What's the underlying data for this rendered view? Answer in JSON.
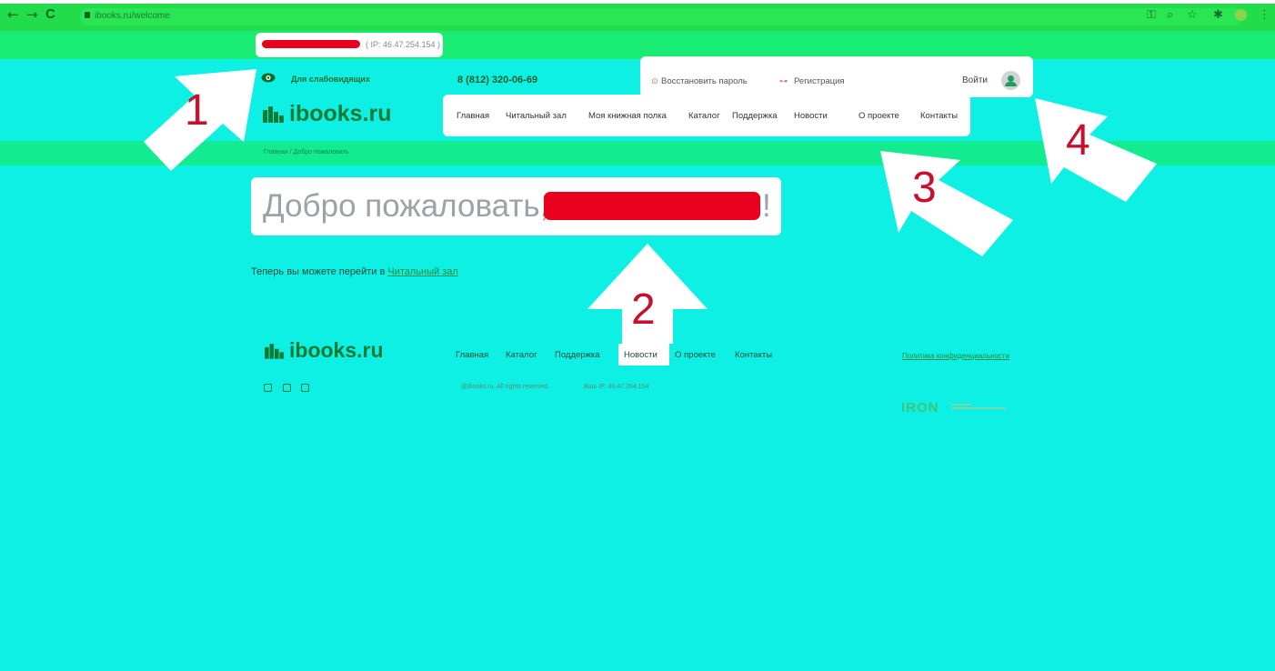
{
  "browser": {
    "url": "ibooks.ru/welcome",
    "back_glyph": "←",
    "forward_glyph": "→",
    "reload_glyph": "C",
    "menu_glyph": "⋮"
  },
  "header": {
    "ip_text": "( IP: 46.47.254.154 )",
    "accessibility_label": "Для слабовидящих",
    "phone": "8 (812) 320-06-69",
    "restore_password": "Восстановить пароль",
    "register": "Регистрация",
    "login": "Войти",
    "logo": "ibooks.ru"
  },
  "nav": {
    "items": [
      "Главная",
      "Читальный зал",
      "Моя книжная полка",
      "Каталог",
      "Поддержка",
      "Новости",
      "О проекте",
      "Контакты"
    ]
  },
  "breadcrumb": {
    "home": "Главная",
    "separator": "/",
    "current": "Добро пожаловать"
  },
  "main": {
    "welcome_title": "Добро пожаловать,",
    "welcome_suffix": "!",
    "reading_text": "Теперь вы можете перейти в",
    "reading_link": "Читальный зал"
  },
  "footer": {
    "logo": "ibooks.ru",
    "nav": [
      "Главная",
      "Каталог",
      "Поддержка",
      "Новости",
      "О проекте",
      "Контакты"
    ],
    "privacy": "Политика конфиденциальности",
    "copyright": "@ibooks.ru. All rights reserved.",
    "your_ip": "Ваш IP: 46.47.254.154",
    "iron": "IRON"
  },
  "callouts": [
    "1",
    "2",
    "3",
    "4"
  ],
  "colors": {
    "page_bg": "#0ff0e4",
    "browser_bar": "#22dc4c",
    "strip": "#18ec72",
    "redaction": "#e8001d",
    "brand_green": "#0b7a32",
    "callout_red": "#c8102e"
  },
  "icons": [
    "eye-icon",
    "logo-mark-icon",
    "avatar-icon",
    "restore-icon",
    "key-icon",
    "social-icon"
  ]
}
